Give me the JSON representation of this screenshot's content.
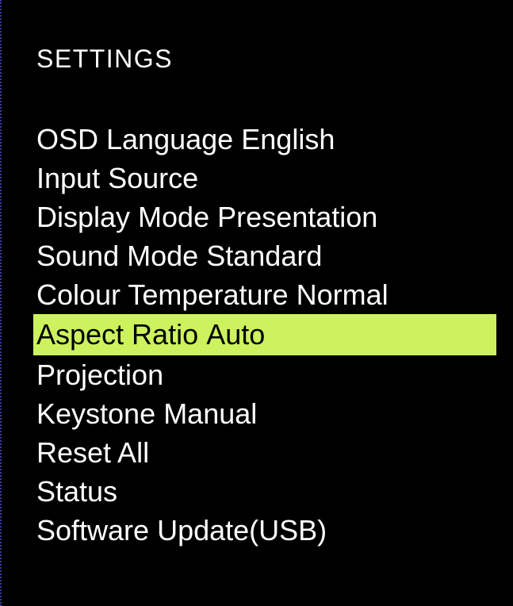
{
  "menu": {
    "title": "SETTINGS",
    "items": [
      {
        "label": "OSD Language",
        "value": "English",
        "selected": false
      },
      {
        "label": "Input Source",
        "value": "",
        "selected": false
      },
      {
        "label": "Display Mode",
        "value": "Presentation",
        "selected": false
      },
      {
        "label": "Sound Mode",
        "value": "Standard",
        "selected": false
      },
      {
        "label": "Colour Temperature",
        "value": "Normal",
        "selected": false
      },
      {
        "label": "Aspect Ratio",
        "value": "Auto",
        "selected": true
      },
      {
        "label": "Projection",
        "value": "",
        "selected": false
      },
      {
        "label": "Keystone",
        "value": "Manual",
        "selected": false
      },
      {
        "label": "Reset All",
        "value": "",
        "selected": false
      },
      {
        "label": "Status",
        "value": "",
        "selected": false
      },
      {
        "label": "Software Update(USB)",
        "value": "",
        "selected": false
      }
    ]
  },
  "colors": {
    "background": "#000000",
    "text": "#ffffff",
    "highlight": "#ccf35f",
    "highlight_text": "#000000"
  }
}
